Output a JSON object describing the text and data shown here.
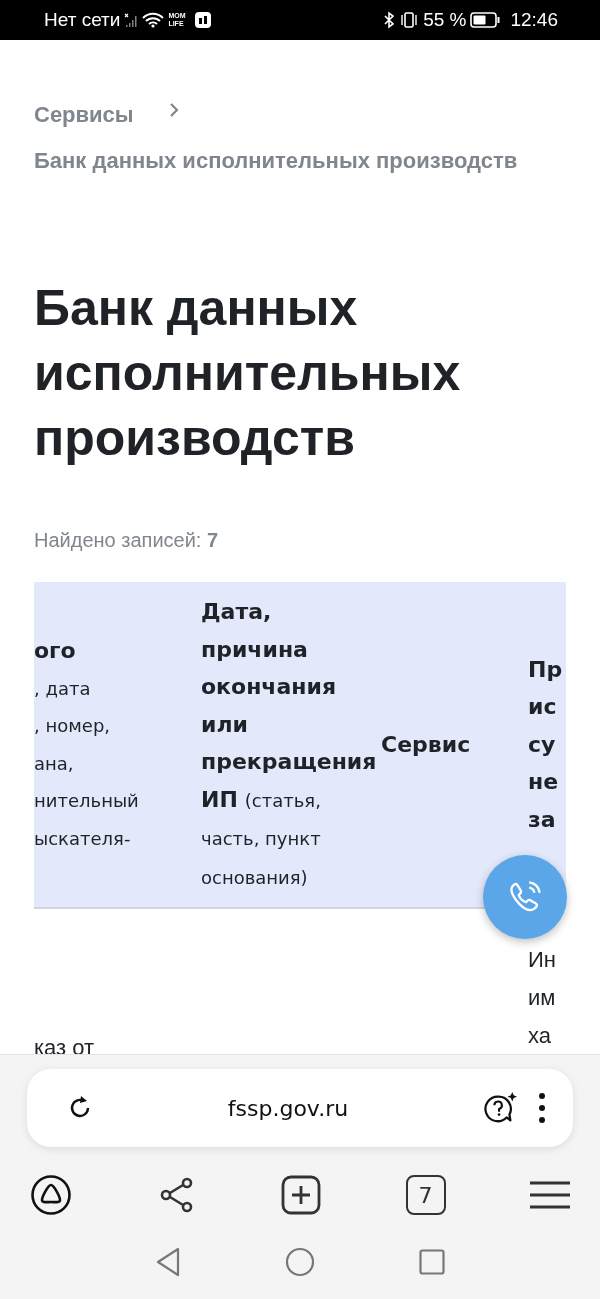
{
  "status_bar": {
    "network": "Нет сети",
    "app_badge": "MOM LIFE",
    "battery": "55 %",
    "time": "12:46"
  },
  "breadcrumbs": [
    {
      "label": "Сервисы"
    },
    {
      "label": "Банк данных исполнительных производств"
    }
  ],
  "title": "Банк данных исполнительных производств",
  "records_found": {
    "label": "Найдено записей:",
    "count": "7"
  },
  "table": {
    "columns": [
      {
        "title": "ого",
        "lines": [
          ", дата",
          ", номер,",
          "ана,",
          "нительный",
          "ыскателя-"
        ]
      },
      {
        "title": "Дата, причина окончания или прекращения ИП",
        "note": "(статья, часть, пункт основания)"
      },
      {
        "title": "Сервис"
      },
      {
        "lines": [
          "Пр",
          "ис",
          "су",
          "не",
          "за"
        ]
      }
    ],
    "rows": [
      {
        "column_1": "каз от",
        "column_4": [
          "Ин",
          "им",
          "ха"
        ]
      }
    ]
  },
  "browser": {
    "url": "fssp.gov.ru",
    "tab_count": "7"
  }
}
